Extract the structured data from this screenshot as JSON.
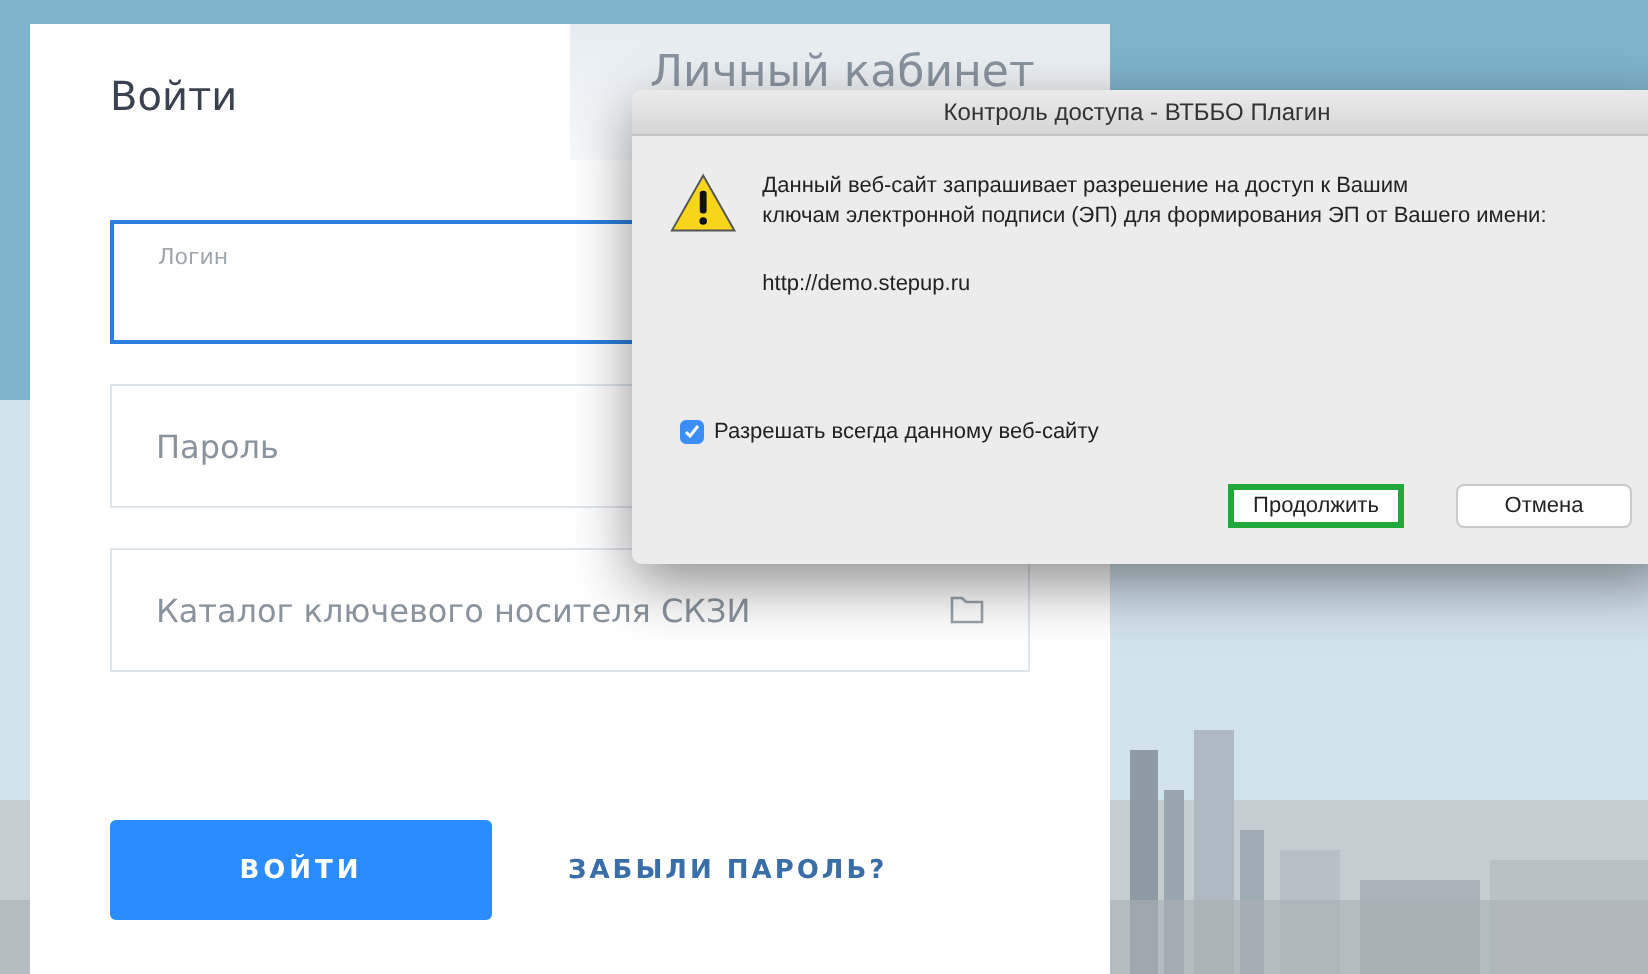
{
  "login_card": {
    "tabs": [
      {
        "label": "Войти",
        "selected": true
      },
      {
        "label": "Личный кабинет",
        "selected": false
      }
    ],
    "fields": [
      {
        "label": "Логин",
        "focused": true,
        "kind": "text"
      },
      {
        "label": "Пароль",
        "focused": false,
        "kind": "text"
      },
      {
        "label": "Каталог ключевого носителя СКЗИ",
        "focused": false,
        "kind": "folder"
      }
    ],
    "submit_button": "ВОЙТИ",
    "forgot_link": "ЗАБЫЛИ ПАРОЛЬ?"
  },
  "dialog": {
    "title": "Контроль доступа - ВТББО Плагин",
    "message_lines": [
      "Данный веб-сайт запрашивает разрешение на доступ к Вашим",
      "ключам электронной подписи (ЭП) для формирования ЭП от Вашего имени:"
    ],
    "url": "http://demo.stepup.ru",
    "checkbox": {
      "label": "Разрешать всегда данному веб-сайту",
      "checked": true
    },
    "buttons": [
      {
        "label": "Продолжить",
        "highlighted": true
      },
      {
        "label": "Отмена",
        "highlighted": false
      }
    ]
  }
}
